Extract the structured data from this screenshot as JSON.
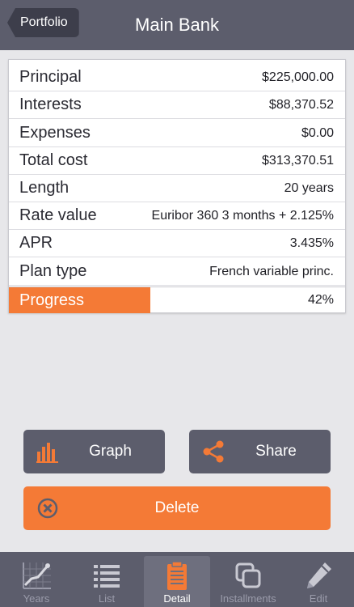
{
  "header": {
    "back_label": "Portfolio",
    "title": "Main Bank"
  },
  "details": [
    {
      "label": "Principal",
      "value": "$225,000.00"
    },
    {
      "label": "Interests",
      "value": "$88,370.52"
    },
    {
      "label": "Expenses",
      "value": "$0.00"
    },
    {
      "label": "Total cost",
      "value": "$313,370.51"
    },
    {
      "label": "Length",
      "value": "20 years"
    },
    {
      "label": "Rate value",
      "value": "Euribor 360 3 months + 2.125%"
    },
    {
      "label": "APR",
      "value": "3.435%"
    },
    {
      "label": "Plan type",
      "value": "French variable princ."
    }
  ],
  "progress": {
    "label": "Progress",
    "value": "42%",
    "fraction": 0.42
  },
  "actions": {
    "graph_label": "Graph",
    "share_label": "Share",
    "delete_label": "Delete"
  },
  "tabs": [
    {
      "label": "Years",
      "icon": "line-chart-icon"
    },
    {
      "label": "List",
      "icon": "list-icon"
    },
    {
      "label": "Detail",
      "icon": "clipboard-icon"
    },
    {
      "label": "Installments",
      "icon": "copy-icon"
    },
    {
      "label": "Edit",
      "icon": "pencil-icon"
    }
  ],
  "colors": {
    "accent": "#f47a36",
    "bar": "#5c5d6c",
    "background": "#e7e7ea"
  }
}
